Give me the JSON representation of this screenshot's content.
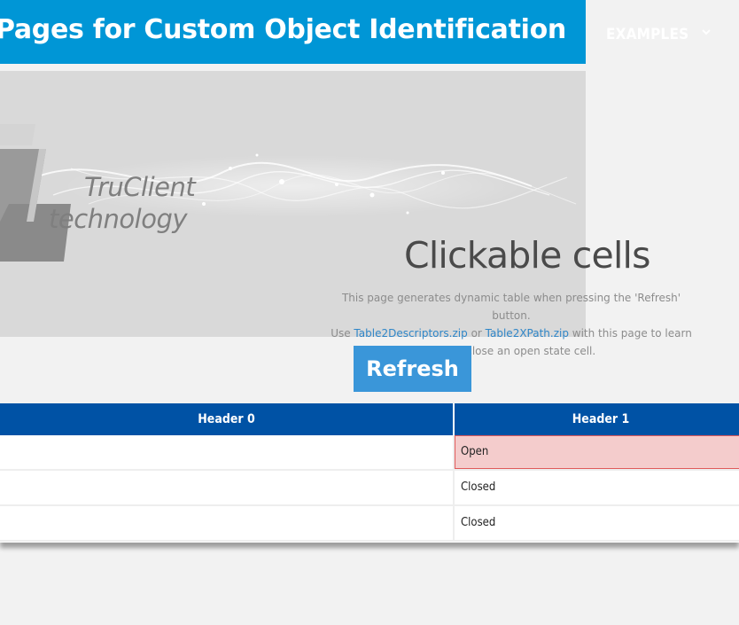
{
  "header": {
    "title": "ple Pages for Custom Object Identification",
    "nav_examples": "EXAMPLES",
    "colors": {
      "title_bg": "#0096d6",
      "nav_text": "#ffffff"
    }
  },
  "hero": {
    "logo_line1": "TruClient",
    "logo_line2": "technology",
    "title": "Clickable cells",
    "desc_part1": "This page generates dynamic table when pressing the 'Refresh' button.",
    "desc_part2a": "Use ",
    "link1": "Table2Descriptors.zip",
    "desc_or": " or ",
    "link2": "Table2XPath.zip",
    "desc_part2b": " with this page to learn",
    "desc_part3": "how to close an open state cell."
  },
  "refresh_label": "Refresh",
  "table": {
    "headers": [
      "Header 0",
      "Header 1"
    ],
    "rows": [
      {
        "c0": "",
        "c1": "Open",
        "state": "open"
      },
      {
        "c0": "",
        "c1": "Closed",
        "state": "closed"
      },
      {
        "c0": "",
        "c1": "Closed",
        "state": "closed"
      }
    ],
    "colors": {
      "header_bg": "#0052a5",
      "open_bg": "#f4cccc",
      "open_border": "#e05a5a"
    }
  }
}
